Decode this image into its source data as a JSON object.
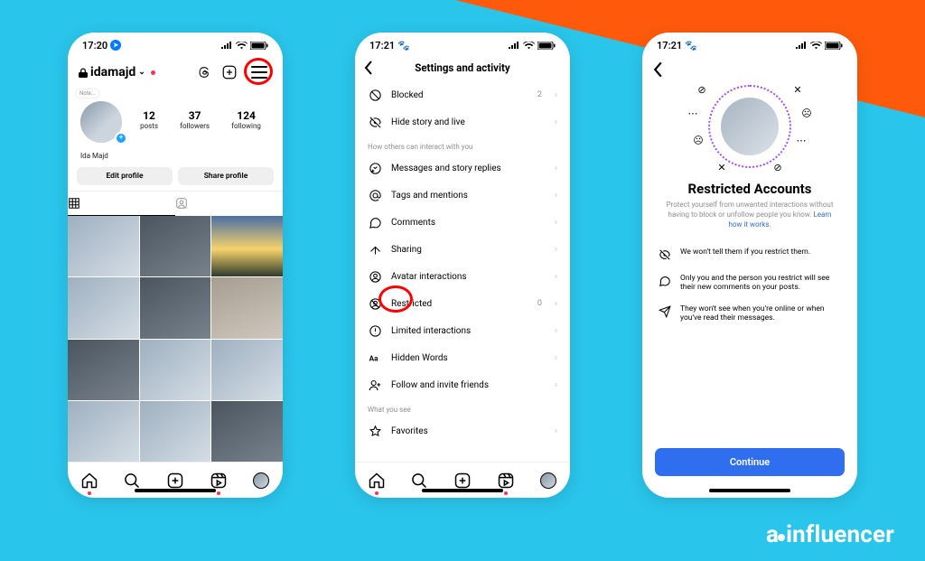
{
  "background": {
    "primary": "#29c5eb",
    "accent": "#ff5a0b"
  },
  "watermark": "ainfluencer",
  "phone1": {
    "status_time": "17:20",
    "username": "idamajd",
    "note_label": "Note...",
    "display_name": "Ida Majd",
    "stats": {
      "posts_n": "12",
      "posts_l": "posts",
      "followers_n": "37",
      "followers_l": "followers",
      "following_n": "124",
      "following_l": "following"
    },
    "edit_btn": "Edit profile",
    "share_btn": "Share profile"
  },
  "phone2": {
    "status_time": "17:21",
    "title": "Settings and activity",
    "rows_top": [
      {
        "icon": "block",
        "label": "Blocked",
        "meta": "2"
      },
      {
        "icon": "hide",
        "label": "Hide story and live",
        "meta": ""
      }
    ],
    "section1": "How others can interact with you",
    "rows_mid": [
      {
        "icon": "messages",
        "label": "Messages and story replies"
      },
      {
        "icon": "at",
        "label": "Tags and mentions"
      },
      {
        "icon": "comment",
        "label": "Comments"
      },
      {
        "icon": "share",
        "label": "Sharing"
      },
      {
        "icon": "avatar",
        "label": "Avatar interactions"
      },
      {
        "icon": "restricted",
        "label": "Restricted",
        "meta": "0",
        "highlight": true
      },
      {
        "icon": "limited",
        "label": "Limited interactions"
      },
      {
        "icon": "aa",
        "label": "Hidden Words"
      },
      {
        "icon": "follow",
        "label": "Follow and invite friends"
      }
    ],
    "section2": "What you see",
    "rows_bot": [
      {
        "icon": "star",
        "label": "Favorites"
      }
    ]
  },
  "phone3": {
    "status_time": "17:21",
    "title": "Restricted Accounts",
    "subtitle_a": "Protect yourself from unwanted interactions without having to block or unfollow people you know. ",
    "subtitle_link": "Learn how it works.",
    "bullets": [
      "We won't tell them if you restrict them.",
      "Only you and the person you restrict will see their new comments on your posts.",
      "They won't see when you're online or when you've read their messages."
    ],
    "continue": "Continue"
  }
}
